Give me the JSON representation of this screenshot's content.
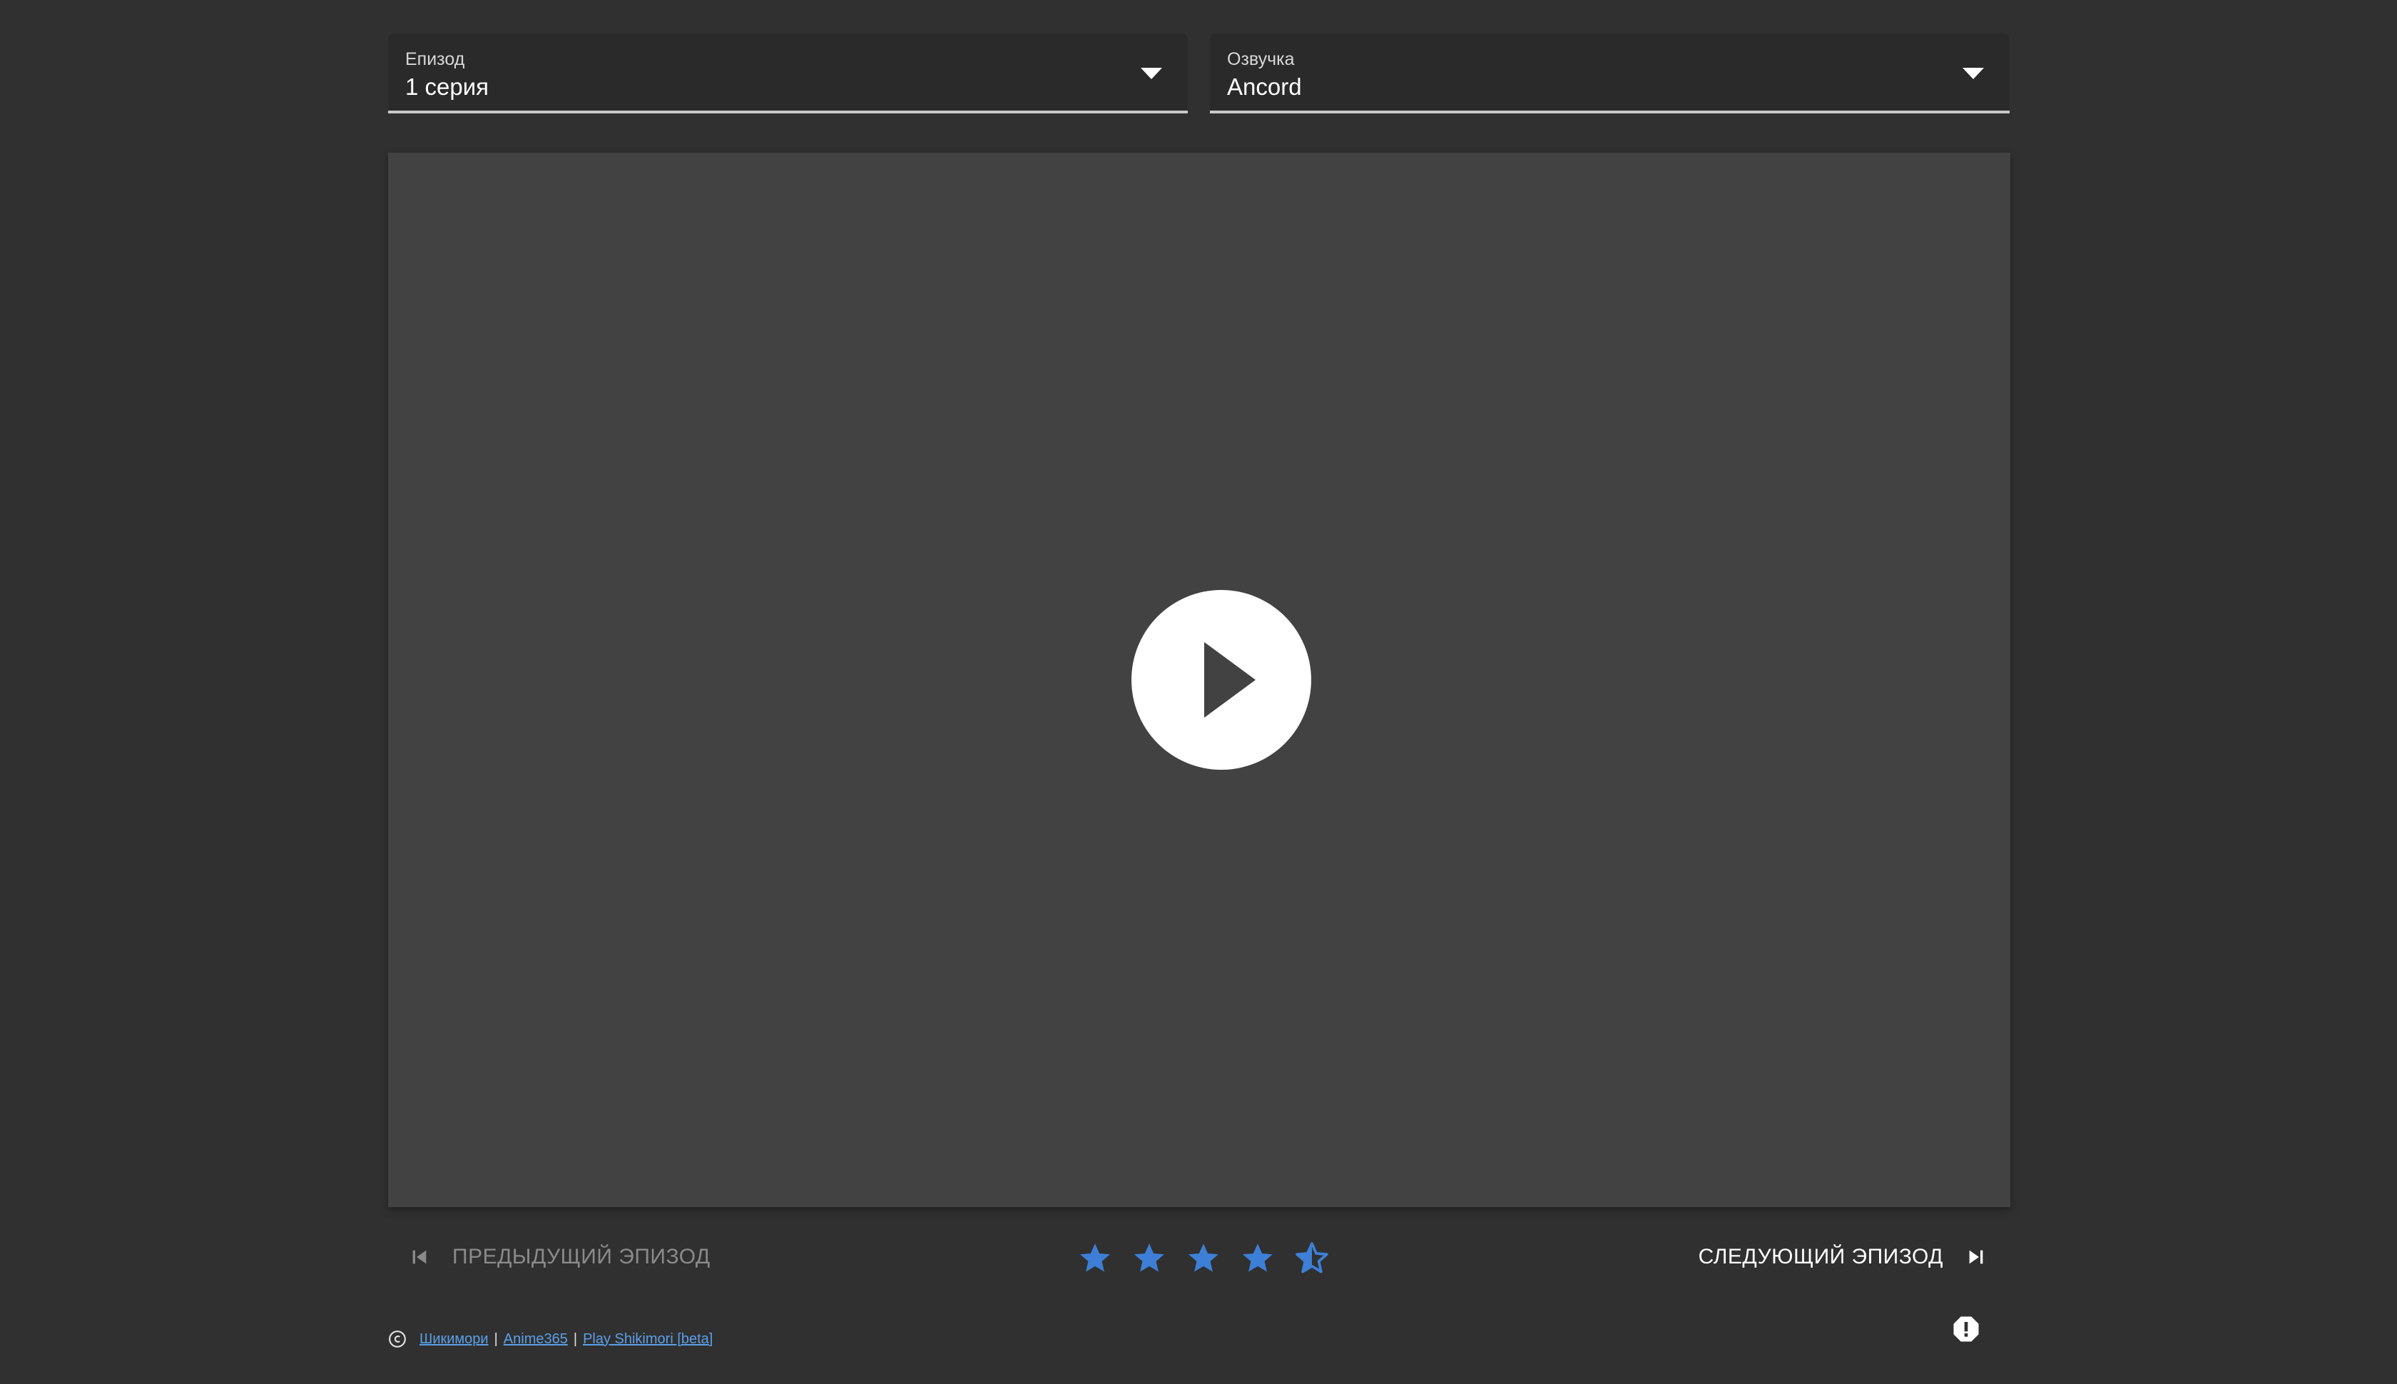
{
  "episode_select": {
    "label": "Епизод",
    "value": "1 серия"
  },
  "voice_select": {
    "label": "Озвучка",
    "value": "Ancord"
  },
  "player": {
    "play_icon": "play-circle-icon"
  },
  "navigation": {
    "prev_label": "ПРЕДЫДУЩИЙ ЭПИЗОД",
    "prev_icon": "skip-previous-icon",
    "next_label": "СЛЕДУЮЩИЙ ЭПИЗОД",
    "next_icon": "skip-next-icon"
  },
  "rating": {
    "value": 4.5,
    "max": 5,
    "color": "#3d7fd6"
  },
  "footer": {
    "copyright_icon": "copyright-icon",
    "links": [
      "Шикимори",
      "Anime365",
      "Play Shikimori [beta]"
    ],
    "separator": "|"
  },
  "report": {
    "icon": "report-icon"
  },
  "colors": {
    "background": "#303030",
    "player": "#424242",
    "accent": "#3d7fd6",
    "link": "#5a9fe8"
  }
}
